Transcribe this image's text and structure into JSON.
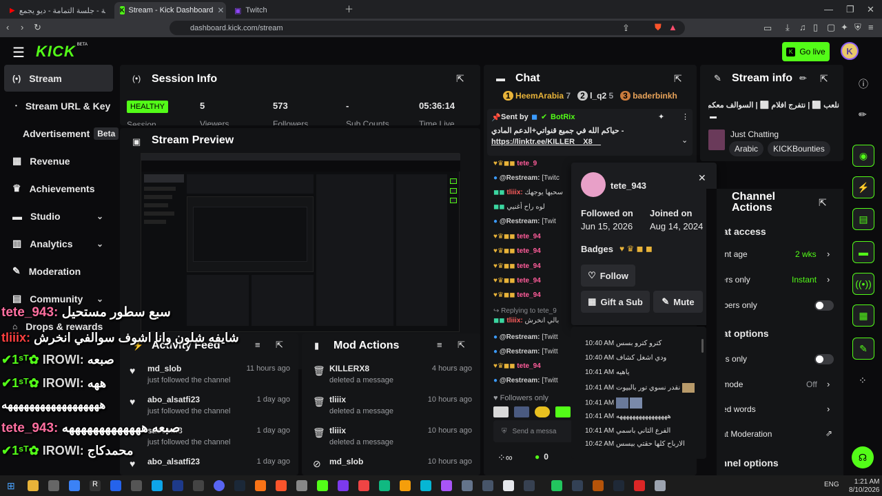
{
  "browser": {
    "tabs": [
      {
        "title": "كما الريشة - جلسة التمامة - ديو يجمع..."
      },
      {
        "title": "Stream - Kick Dashboard"
      },
      {
        "title": "Twitch"
      }
    ],
    "url": "dashboard.kick.com/stream"
  },
  "header": {
    "logo": "KICK",
    "logo_sup": "BETA",
    "go_live": "Go live",
    "avatar_letter": "K"
  },
  "sidebar": {
    "items": [
      {
        "label": "Stream",
        "icon": "stream-icon"
      },
      {
        "label": "Stream URL & Key"
      },
      {
        "label": "Advertisement",
        "badge": "Beta"
      },
      {
        "label": "Revenue",
        "icon": "revenue-icon"
      },
      {
        "label": "Achievements",
        "icon": "trophy-icon"
      },
      {
        "label": "Studio",
        "icon": "studio-icon"
      },
      {
        "label": "Analytics",
        "icon": "analytics-icon"
      },
      {
        "label": "Moderation",
        "icon": "wrench-icon"
      },
      {
        "label": "Community",
        "icon": "community-icon"
      },
      {
        "label": "Drops & rewards",
        "icon": "drops-icon"
      }
    ]
  },
  "session": {
    "title": "Session Info",
    "status": "HEALTHY",
    "status_label": "Session",
    "stats": [
      {
        "value": "5",
        "label": "Viewers"
      },
      {
        "value": "573",
        "label": "Followers"
      },
      {
        "value": "-",
        "label": "Sub Counts"
      },
      {
        "value": "05:36:14",
        "label": "Time Live"
      }
    ]
  },
  "preview": {
    "title": "Stream Preview"
  },
  "activity": {
    "title": "Activity Feed",
    "items": [
      {
        "name": "md_slob",
        "desc": "just followed the channel",
        "time": "11 hours ago"
      },
      {
        "name": "abo_alsatfi23",
        "desc": "just followed the channel",
        "time": "1 day ago"
      },
      {
        "name": "saeeem8",
        "desc": "just followed the channel",
        "time": "1 day ago"
      },
      {
        "name": "abo_alsatfi23",
        "desc": "",
        "time": "1 day ago"
      }
    ]
  },
  "mod": {
    "title": "Mod Actions",
    "items": [
      {
        "name": "KILLERX8",
        "desc": "deleted a message",
        "time": "4 hours ago"
      },
      {
        "name": "tliiix",
        "desc": "deleted a message",
        "time": "10 hours ago"
      },
      {
        "name": "tliiix",
        "desc": "deleted a message",
        "time": "10 hours ago"
      },
      {
        "name": "md_slob",
        "desc": "",
        "time": "10 hours ago"
      }
    ]
  },
  "chat": {
    "title": "Chat",
    "top_gifters": [
      {
        "name": "HeemArabia",
        "count": "7"
      },
      {
        "name": "l_q2",
        "count": "5"
      },
      {
        "name": "baderbinkh"
      }
    ],
    "pinned": {
      "sent_by": "Sent by",
      "sender": "BotRix",
      "text": "- حياكم الله في جميع قنواتي+الدعم المادي",
      "link": "https://linktr.ee/KILLER__X8__"
    },
    "lines": [
      {
        "user": "tete_9",
        "text": ""
      },
      {
        "user": "@Restream:",
        "text": "[Twitc"
      },
      {
        "user": "tliiix:",
        "text": "سحبها يوجهك"
      },
      {
        "user": "",
        "text": "لوه راح أغنيي"
      },
      {
        "user": "@Restream:",
        "text": "[Twit"
      },
      {
        "user": "tete_94",
        "text": ""
      },
      {
        "user": "tete_94",
        "text": ""
      },
      {
        "user": "tete_94",
        "text": ""
      },
      {
        "user": "tete_94",
        "text": ""
      },
      {
        "user": "tete_94",
        "text": ""
      },
      {
        "user": "Replying to tete_9",
        "text": ""
      },
      {
        "user": "tliiix:",
        "text": "بالي انخرش"
      },
      {
        "user": "@Restream:",
        "text": "[Twitt"
      },
      {
        "user": "@Restream:",
        "text": "[Twitt"
      },
      {
        "user": "tete_94",
        "text": ""
      },
      {
        "user": "@Restream:",
        "text": "[Twitt"
      }
    ],
    "followers_only": "Followers only",
    "send_placeholder": "Send a messa",
    "bottom_count": "0"
  },
  "user_card": {
    "username": "tete_943",
    "followed_label": "Followed on",
    "followed_date": "Jun 15, 2026",
    "joined_label": "Joined on",
    "joined_date": "Aug 14, 2024",
    "badges_label": "Badges",
    "follow": "Follow",
    "gift": "Gift a Sub",
    "mute": "Mute",
    "messages": [
      {
        "time": "10:40 AM",
        "text": "كترو كترو بسس"
      },
      {
        "time": "10:40 AM",
        "text": "ودي اشغل كشاف"
      },
      {
        "time": "10:41 AM",
        "text": "ياهيه"
      },
      {
        "time": "10:41 AM",
        "text": "نقدر نسوي تور بالبيوت"
      },
      {
        "time": "10:41 AM",
        "text": ""
      },
      {
        "time": "10:41 AM",
        "text": "ههههههههههههههههه"
      },
      {
        "time": "10:41 AM",
        "text": "الفرع الثاني باسمي"
      },
      {
        "time": "10:42 AM",
        "text": "الارباح كلها حقتي بيسس"
      }
    ]
  },
  "stream_info": {
    "title": "Stream info",
    "stream_title": "نلعب ⬜ | نتفرج افلام ⬜ | السوالف معكم",
    "category": "Just Chatting",
    "tags": [
      "Arabic",
      "KICKBounties"
    ]
  },
  "channel_actions": {
    "title": "Channel Actions",
    "access_header": "Chat access",
    "rows": [
      {
        "label": "Account age",
        "value": "2 wks"
      },
      {
        "label": "Followers only",
        "value": "Instant"
      },
      {
        "label": "Subscribers only",
        "value": ""
      }
    ],
    "chat_header": "Chat options",
    "rows2": [
      {
        "label": "Emotes only",
        "value": ""
      },
      {
        "label": "Slow mode",
        "value": "Off"
      },
      {
        "label": "Banned words",
        "value": ""
      },
      {
        "label": "AI Chat Moderation",
        "value": ""
      }
    ],
    "channel_header": "Channel options"
  },
  "overlay": {
    "lines": [
      {
        "user": "tete_943:",
        "text": "سبع سطور مستحيل"
      },
      {
        "user": "tliiix:",
        "text": "شايفه شلون وانا اشوف سوالفي انخرش"
      },
      {
        "user": "IROWI:",
        "text": "صبعه"
      },
      {
        "user": "IROWI:",
        "text": "ههه"
      },
      {
        "user": "",
        "text": "ههههههههههههههههههه"
      },
      {
        "user": "tete_943:",
        "text": "صبعه هههههههههههههه"
      },
      {
        "user": "IROWI:",
        "text": "محمدكاج"
      }
    ]
  },
  "taskbar": {
    "lang": "ENG",
    "time": "1:21 AM",
    "date": "8/10/2026"
  },
  "colors": {
    "accent": "#53fc18",
    "panel": "#141517",
    "bg": "#0b0b0d"
  }
}
